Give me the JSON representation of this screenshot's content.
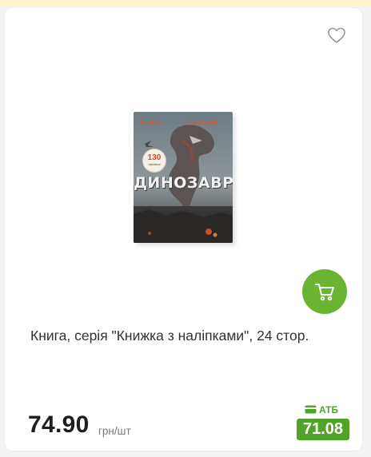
{
  "product": {
    "title": "Книга, серія \"Книжка з наліпками\", 24 стор.",
    "price": "74.90",
    "unit": "грн/шт",
    "club_label": "АТБ",
    "club_price": "71.08",
    "image": {
      "cover_label_left": "Книжка",
      "cover_label_right": "з наліпками",
      "cover_badge_number": "130",
      "cover_badge_text": "наліпок",
      "cover_title": "ДИНОЗАВРИ"
    }
  },
  "icons": {
    "favorite": "heart-outline-icon",
    "cart": "shopping-cart-icon",
    "club_card": "card-icon"
  },
  "colors": {
    "accent_green": "#69b533",
    "club_green": "#52a428",
    "top_strip": "#fff6c9"
  }
}
